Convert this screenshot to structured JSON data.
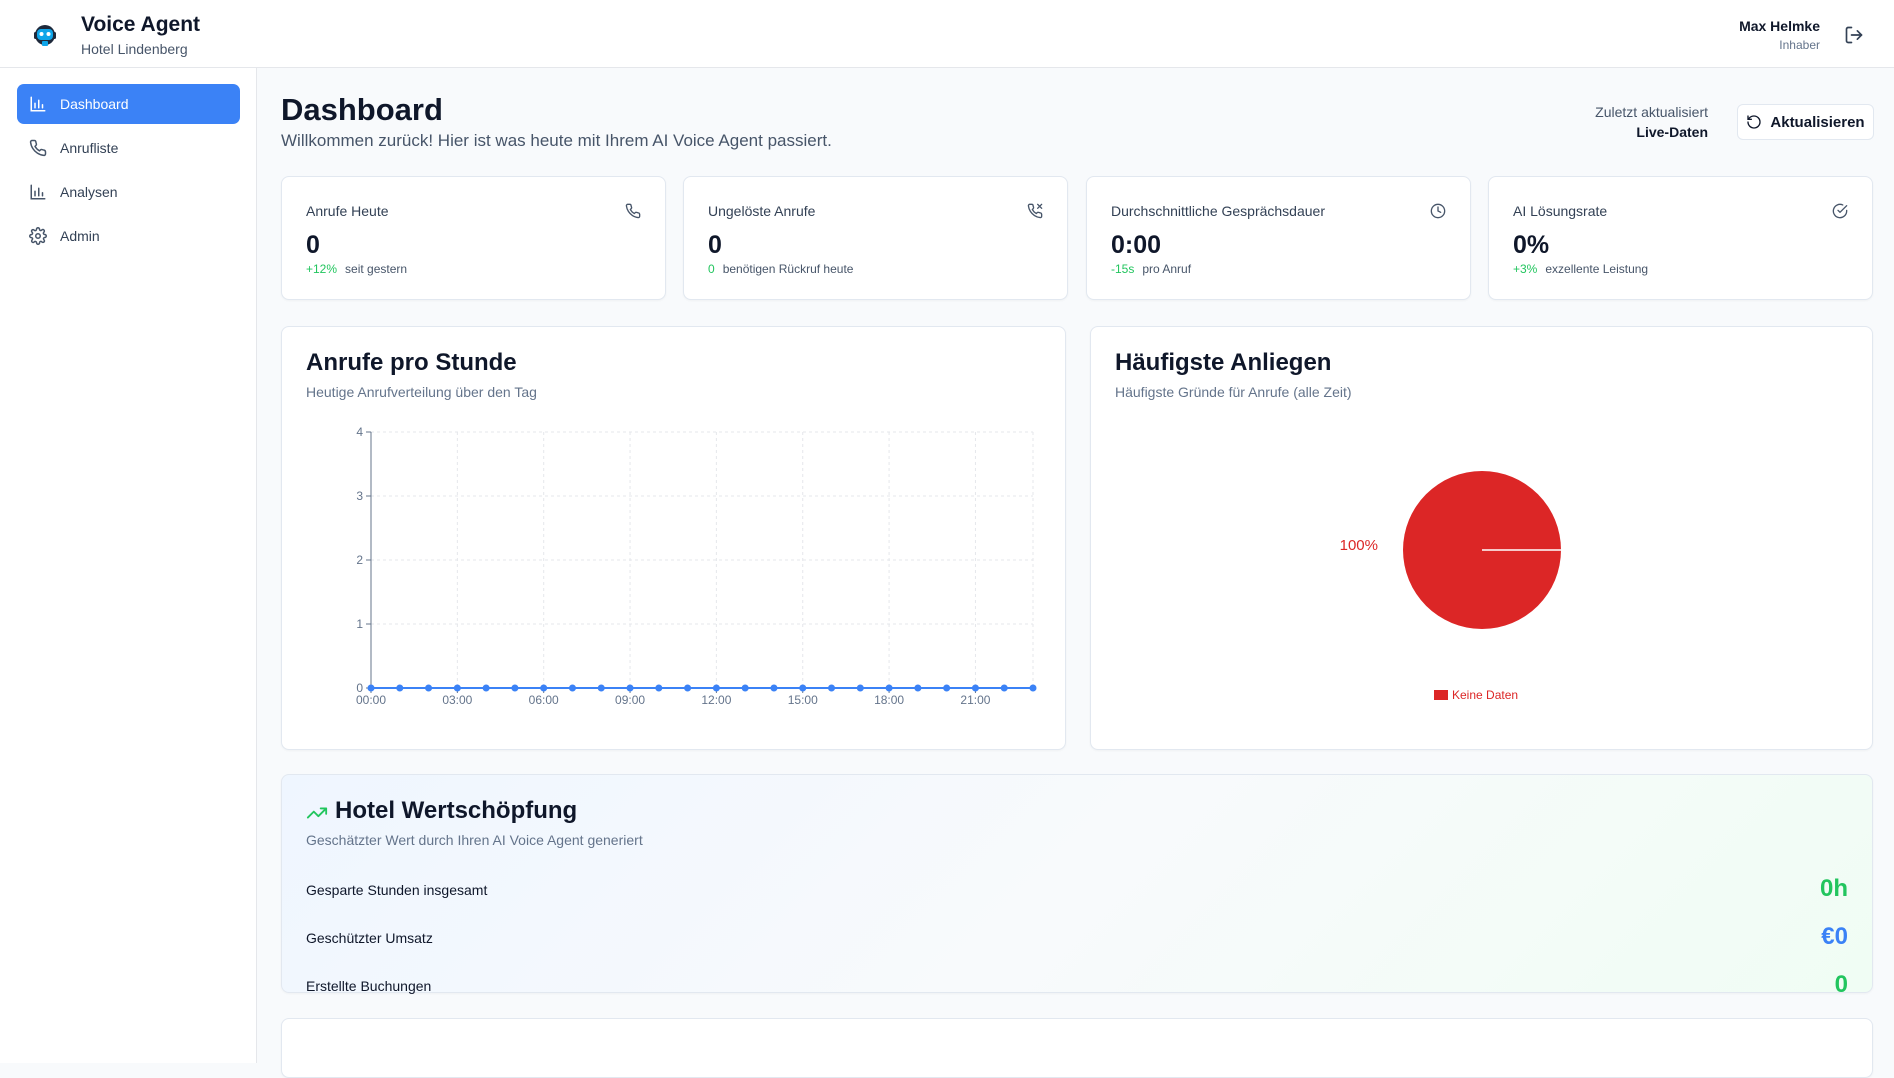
{
  "app": {
    "title": "Voice Agent",
    "subtitle": "Hotel Lindenberg"
  },
  "user": {
    "name": "Max Helmke",
    "role": "Inhaber"
  },
  "sidebar": {
    "items": [
      {
        "label": "Dashboard",
        "icon": "bar-chart-icon",
        "active": true
      },
      {
        "label": "Anrufliste",
        "icon": "phone-icon",
        "active": false
      },
      {
        "label": "Analysen",
        "icon": "bar-chart-icon",
        "active": false
      },
      {
        "label": "Admin",
        "icon": "gear-icon",
        "active": false
      }
    ]
  },
  "header": {
    "title": "Dashboard",
    "subtitle": "Willkommen zurück! Hier ist was heute mit Ihrem AI Voice Agent passiert.",
    "updated_label": "Zuletzt aktualisiert",
    "updated_value": "Live-Daten",
    "refresh_label": "Aktualisieren"
  },
  "stats": [
    {
      "label": "Anrufe Heute",
      "value": "0",
      "delta": "+12%",
      "note": "seit gestern",
      "icon": "phone-icon"
    },
    {
      "label": "Ungelöste Anrufe",
      "value": "0",
      "delta": "0",
      "note": "benötigen Rückruf heute",
      "icon": "phone-missed-icon"
    },
    {
      "label": "Durchschnittliche Gesprächsdauer",
      "value": "0:00",
      "delta": "-15s",
      "note": "pro Anruf",
      "icon": "clock-icon"
    },
    {
      "label": "AI Lösungsrate",
      "value": "0%",
      "delta": "+3%",
      "note": "exzellente Leistung",
      "icon": "check-circle-icon"
    }
  ],
  "calls_chart": {
    "title": "Anrufe pro Stunde",
    "subtitle": "Heutige Anrufverteilung über den Tag"
  },
  "topics_chart": {
    "title": "Häufigste Anliegen",
    "subtitle": "Häufigste Gründe für Anrufe (alle Zeit)",
    "slice_label": "100%",
    "legend_label": "Keine Daten"
  },
  "value": {
    "title": "Hotel Wertschöpfung",
    "subtitle": "Geschätzter Wert durch Ihren AI Voice Agent generiert",
    "rows": [
      {
        "label": "Gesparte Stunden insgesamt",
        "value": "0h",
        "color": "#22c55e"
      },
      {
        "label": "Geschützter Umsatz",
        "value": "€0",
        "color": "#3b82f6"
      },
      {
        "label": "Erstellte Buchungen",
        "value": "0",
        "color": "#22c55e"
      }
    ]
  },
  "colors": {
    "accent": "#3b82f6",
    "positive": "#22c55e",
    "pie": "#dc2626"
  },
  "chart_data": [
    {
      "type": "line",
      "x": [
        "00:00",
        "01:00",
        "02:00",
        "03:00",
        "04:00",
        "05:00",
        "06:00",
        "07:00",
        "08:00",
        "09:00",
        "10:00",
        "11:00",
        "12:00",
        "13:00",
        "14:00",
        "15:00",
        "16:00",
        "17:00",
        "18:00",
        "19:00",
        "20:00",
        "21:00",
        "22:00",
        "23:00"
      ],
      "tick_labels": [
        "00:00",
        "03:00",
        "06:00",
        "09:00",
        "12:00",
        "15:00",
        "18:00",
        "21:00"
      ],
      "series": [
        {
          "values": [
            0,
            0,
            0,
            0,
            0,
            0,
            0,
            0,
            0,
            0,
            0,
            0,
            0,
            0,
            0,
            0,
            0,
            0,
            0,
            0,
            0,
            0,
            0,
            0
          ]
        }
      ],
      "ylim": [
        0,
        4
      ],
      "yticks": [
        0,
        1,
        2,
        3,
        4
      ],
      "grid": true,
      "title": "",
      "xlabel": "",
      "ylabel": ""
    },
    {
      "type": "pie",
      "categories": [
        "Keine Daten"
      ],
      "values": [
        100
      ],
      "labels": [
        "100%"
      ],
      "legend": "bottom"
    }
  ]
}
